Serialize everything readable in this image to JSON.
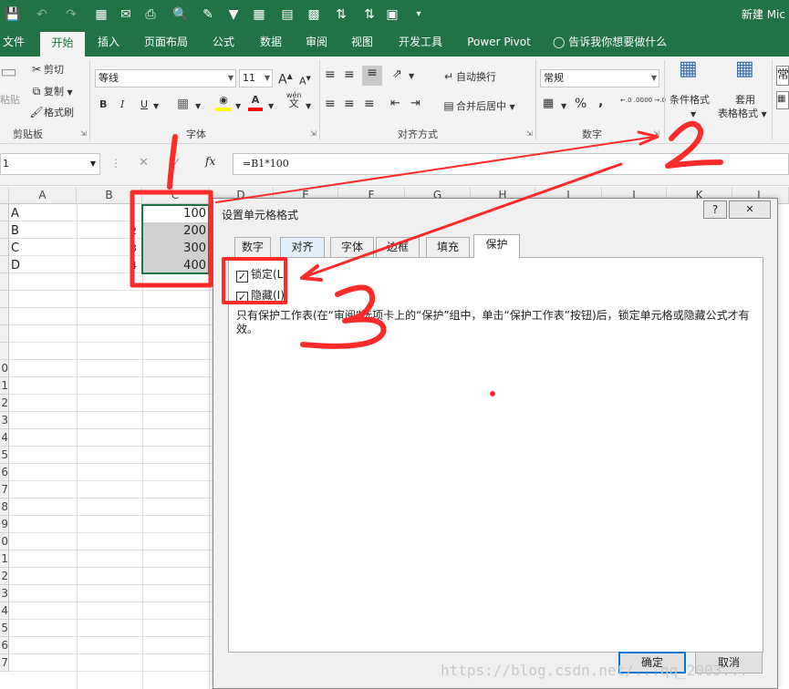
{
  "window": {
    "app_title": "新建 Mic"
  },
  "ribbon_tabs": [
    "文件",
    "开始",
    "插入",
    "页面布局",
    "公式",
    "数据",
    "审阅",
    "视图",
    "开发工具",
    "Power Pivot"
  ],
  "active_tab": "开始",
  "tell_me": "告诉我你想要做什么",
  "clipboard": {
    "paste": "粘贴",
    "cut": "剪切",
    "copy": "复制",
    "format_painter": "格式刷",
    "group_label": "剪贴板"
  },
  "font": {
    "name": "等线",
    "size": "11",
    "grow": "A",
    "shrink": "A",
    "bold": "B",
    "italic": "I",
    "underline": "U",
    "wen": "wén",
    "wen_char": "文",
    "group_label": "字体",
    "fill_color": "#ffff00",
    "text_color": "#ff0000"
  },
  "alignment": {
    "wrap_text": "自动换行",
    "merge_center": "合并后居中",
    "group_label": "对齐方式"
  },
  "number": {
    "format": "常规",
    "percent": "%",
    "comma": ",",
    "inc_decimal": "←.0 .00",
    "dec_decimal": ".00 →.0",
    "group_label": "数字"
  },
  "styles": {
    "conditional": "条件格式",
    "table_format_1": "套用",
    "table_format_2": "表格格式",
    "cell_style_char": "常"
  },
  "formula_bar": {
    "name_box": "1",
    "fx": "fx",
    "formula": "=B1*100"
  },
  "sheet": {
    "columns": [
      "A",
      "B",
      "C",
      "D",
      "E",
      "F",
      "G",
      "H",
      "I",
      "J",
      "K",
      "L"
    ],
    "row_labels": [
      "",
      "",
      "",
      "",
      "",
      "",
      "",
      "",
      "",
      "0",
      "1",
      "2",
      "3",
      "4",
      "5",
      "6",
      "7",
      "8",
      "9",
      "0",
      "1",
      "2",
      "3",
      "4",
      "5",
      "6",
      "7"
    ],
    "col_a": [
      "A",
      "B",
      "C",
      "D"
    ],
    "col_c": [
      "100",
      "200",
      "300",
      "400"
    ],
    "c_prefix": [
      "",
      "2",
      "3",
      "4"
    ]
  },
  "dialog": {
    "title": "设置单元格格式",
    "help": "?",
    "close": "✕",
    "tabs": [
      "数字",
      "对齐",
      "字体",
      "边框",
      "填充",
      "保护"
    ],
    "hot_tab": "对齐",
    "selected_tab": "保护",
    "locked_label": "锁定(L)",
    "hidden_label": "隐藏(I)",
    "locked_checked": true,
    "hidden_checked": true,
    "description": "只有保护工作表(在“审阅”选项卡上的“保护”组中，单击“保护工作表”按钮)后，锁定单元格或隐藏公式才有效。",
    "ok": "确定",
    "cancel": "取消"
  },
  "annotations": {
    "labels": [
      "1",
      "2",
      "3"
    ],
    "color": "#ff2a2a"
  },
  "watermark": "https://blog.csdn.net/...qq_2003..."
}
